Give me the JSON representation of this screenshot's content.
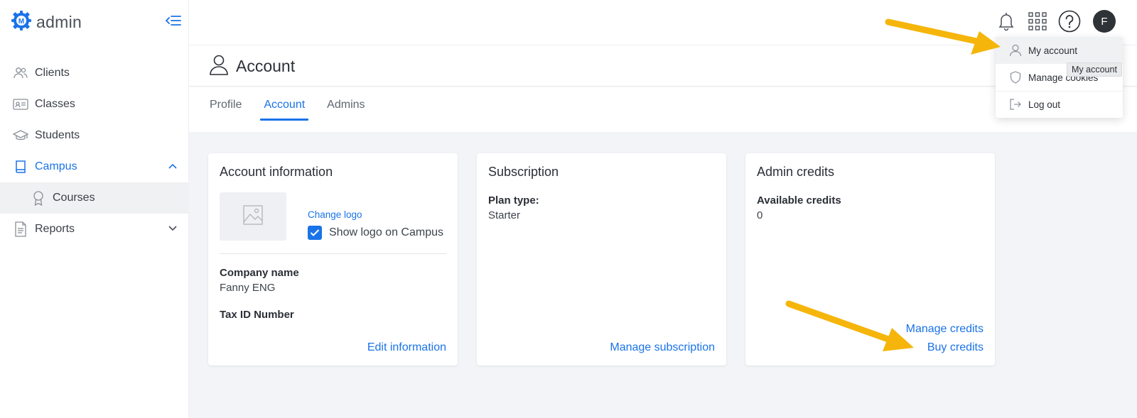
{
  "brand": {
    "name": "admin",
    "logo_letter": "M",
    "accent": "#1a73e8"
  },
  "sidebar": {
    "items": [
      {
        "label": "Clients",
        "icon": "users-icon"
      },
      {
        "label": "Classes",
        "icon": "id-card-icon"
      },
      {
        "label": "Students",
        "icon": "graduation-cap-icon"
      },
      {
        "label": "Campus",
        "icon": "book-icon",
        "active": true,
        "expanded": true
      },
      {
        "label": "Courses",
        "icon": "award-icon",
        "sub": true
      },
      {
        "label": "Reports",
        "icon": "document-icon",
        "expanded": false
      }
    ]
  },
  "topbar": {
    "avatar_initial": "F",
    "icons": [
      "bell-icon",
      "apps-grid-icon",
      "help-icon"
    ]
  },
  "page": {
    "title": "Account",
    "tabs": [
      {
        "label": "Profile"
      },
      {
        "label": "Account",
        "active": true
      },
      {
        "label": "Admins"
      }
    ]
  },
  "cards": {
    "account_info": {
      "title": "Account information",
      "change_logo": "Change logo",
      "show_logo_label": "Show logo on Campus",
      "show_logo_checked": true,
      "company_name_label": "Company name",
      "company_name_value": "Fanny ENG",
      "tax_id_label": "Tax ID Number",
      "edit_link": "Edit information"
    },
    "subscription": {
      "title": "Subscription",
      "plan_type_label": "Plan type:",
      "plan_type_value": "Starter",
      "manage_link": "Manage subscription"
    },
    "admin_credits": {
      "title": "Admin credits",
      "available_label": "Available credits",
      "available_value": "0",
      "manage_link": "Manage credits",
      "buy_link": "Buy credits"
    }
  },
  "dropdown": {
    "items": [
      {
        "label": "My account",
        "icon": "user-icon"
      },
      {
        "label": "Manage cookies",
        "icon": "shield-icon"
      },
      {
        "label": "Log out",
        "icon": "logout-icon"
      }
    ],
    "tooltip": "My account"
  },
  "annotation_color": "#f5b50a"
}
